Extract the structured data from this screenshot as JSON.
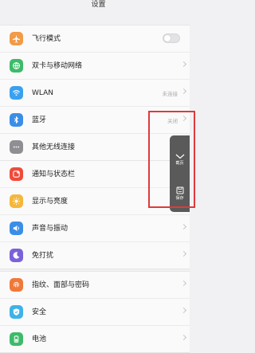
{
  "header": {
    "title": "设置"
  },
  "groups": [
    {
      "items": [
        {
          "label": "飞行模式",
          "icon": "airplane-icon",
          "color": "#f19a48",
          "control": "toggle",
          "on": false
        },
        {
          "label": "双卡与移动网络",
          "icon": "cellular-icon",
          "color": "#3dbb6a"
        },
        {
          "label": "WLAN",
          "icon": "wifi-icon",
          "color": "#3aa0f0",
          "value": "未连接"
        },
        {
          "label": "蓝牙",
          "icon": "bluetooth-icon",
          "color": "#3a8ee8",
          "value": "关闭"
        },
        {
          "label": "其他无线连接",
          "icon": "more-icon",
          "color": "#8e8e93"
        }
      ]
    },
    {
      "items": [
        {
          "label": "通知与状态栏",
          "icon": "notification-icon",
          "color": "#f04b3a"
        },
        {
          "label": "显示与亮度",
          "icon": "brightness-icon",
          "color": "#f5b73b"
        },
        {
          "label": "声音与振动",
          "icon": "sound-icon",
          "color": "#3a8ee8"
        },
        {
          "label": "免打扰",
          "icon": "moon-icon",
          "color": "#7b62d9"
        }
      ]
    },
    {
      "items": [
        {
          "label": "指纹、面部与密码",
          "icon": "fingerprint-icon",
          "color": "#f0793a"
        },
        {
          "label": "安全",
          "icon": "shield-icon",
          "color": "#3fb2e8"
        },
        {
          "label": "电池",
          "icon": "battery-icon",
          "color": "#3dbb6a"
        }
      ]
    }
  ],
  "floating_panel": {
    "collapse_label": "截页",
    "save_label": "保存",
    "collapse_icon": "chevron-down-icon",
    "save_icon": "save-icon"
  },
  "annotation": {
    "frame_color": "#e03a3a"
  }
}
